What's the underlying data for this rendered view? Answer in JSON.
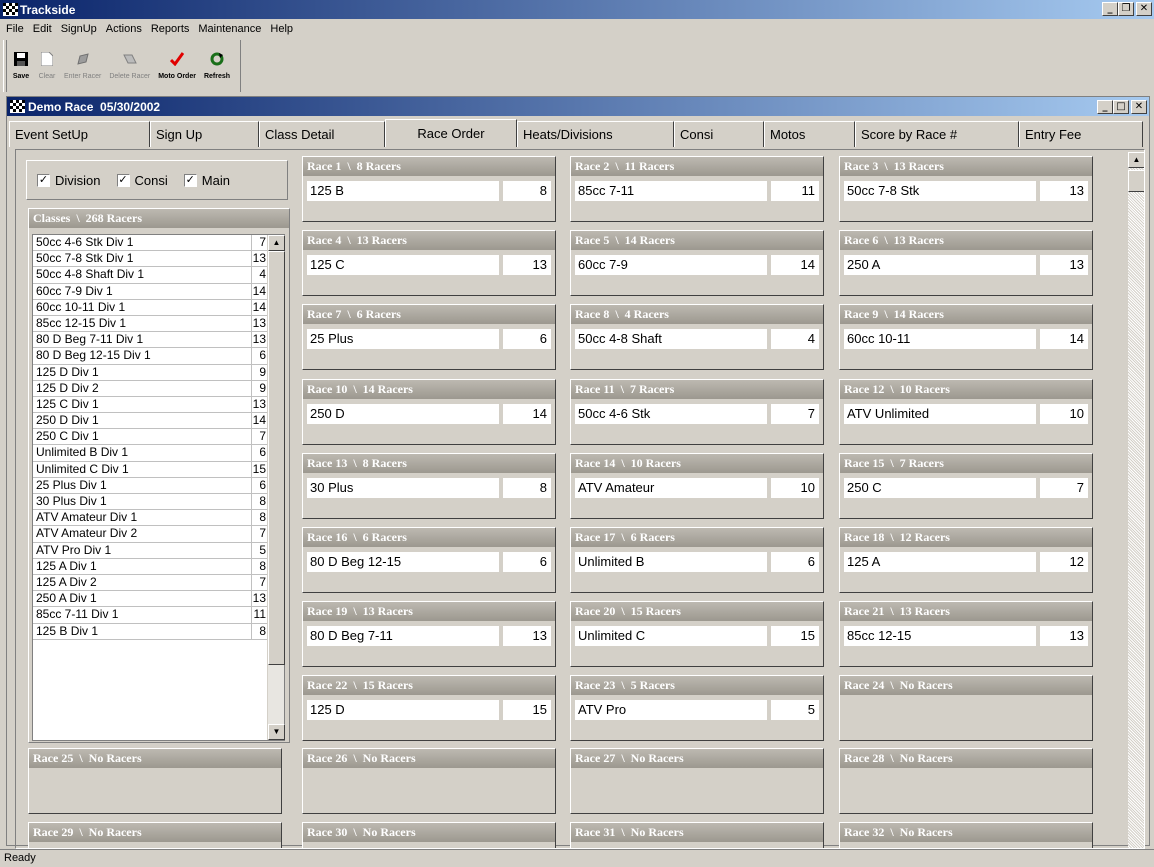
{
  "app": {
    "title": "Trackside"
  },
  "menu": [
    "File",
    "Edit",
    "SignUp",
    "Actions",
    "Reports",
    "Maintenance",
    "Help"
  ],
  "toolbar": {
    "save": "Save",
    "clear": "Clear",
    "enter_racer": "Enter Racer",
    "delete_racer": "Delete Racer",
    "moto_order": "Moto Order",
    "refresh": "Refresh"
  },
  "child": {
    "title": "Demo Race  05/30/2002"
  },
  "tabs": [
    "Event SetUp",
    "Sign Up",
    "Class Detail",
    "Race Order",
    "Heats/Divisions",
    "Consi",
    "Motos",
    "Score by Race #",
    "Entry Fee"
  ],
  "filters": {
    "division": "Division",
    "consi": "Consi",
    "main": "Main"
  },
  "classes": {
    "header": "Classes  \\  268 Racers",
    "rows": [
      {
        "name": "50cc 4-6 Stk Div 1",
        "count": "7"
      },
      {
        "name": "50cc 7-8 Stk Div 1",
        "count": "13"
      },
      {
        "name": "50cc 4-8 Shaft Div 1",
        "count": "4"
      },
      {
        "name": "60cc 7-9 Div 1",
        "count": "14"
      },
      {
        "name": "60cc 10-11 Div 1",
        "count": "14"
      },
      {
        "name": "85cc 12-15 Div 1",
        "count": "13"
      },
      {
        "name": "80 D Beg 7-11 Div 1",
        "count": "13"
      },
      {
        "name": "80 D Beg 12-15 Div 1",
        "count": "6"
      },
      {
        "name": "125 D Div 1",
        "count": "9"
      },
      {
        "name": "125 D Div 2",
        "count": "9"
      },
      {
        "name": "125 C Div 1",
        "count": "13"
      },
      {
        "name": "250 D Div 1",
        "count": "14"
      },
      {
        "name": "250 C Div 1",
        "count": "7"
      },
      {
        "name": "Unlimited B Div 1",
        "count": "6"
      },
      {
        "name": "Unlimited C Div 1",
        "count": "15"
      },
      {
        "name": "25 Plus Div 1",
        "count": "6"
      },
      {
        "name": "30 Plus Div 1",
        "count": "8"
      },
      {
        "name": "ATV Amateur Div 1",
        "count": "8"
      },
      {
        "name": "ATV Amateur Div 2",
        "count": "7"
      },
      {
        "name": "ATV Pro Div 1",
        "count": "5"
      },
      {
        "name": "125 A Div 1",
        "count": "8"
      },
      {
        "name": "125 A Div 2",
        "count": "7"
      },
      {
        "name": "250 A Div 1",
        "count": "13"
      },
      {
        "name": "85cc 7-11 Div 1",
        "count": "11"
      },
      {
        "name": "125 B Div 1",
        "count": "8"
      }
    ]
  },
  "races": [
    {
      "header": "Race 1  \\  8 Racers",
      "name": "125 B",
      "count": "8"
    },
    {
      "header": "Race 2  \\  11 Racers",
      "name": "85cc 7-11",
      "count": "11"
    },
    {
      "header": "Race 3  \\  13 Racers",
      "name": "50cc 7-8 Stk",
      "count": "13"
    },
    {
      "header": "Race 4  \\  13 Racers",
      "name": "125 C",
      "count": "13"
    },
    {
      "header": "Race 5  \\  14 Racers",
      "name": "60cc 7-9",
      "count": "14"
    },
    {
      "header": "Race 6  \\  13 Racers",
      "name": "250 A",
      "count": "13"
    },
    {
      "header": "Race 7  \\  6 Racers",
      "name": "25 Plus",
      "count": "6"
    },
    {
      "header": "Race 8  \\  4 Racers",
      "name": "50cc 4-8 Shaft",
      "count": "4"
    },
    {
      "header": "Race 9  \\  14 Racers",
      "name": "60cc 10-11",
      "count": "14"
    },
    {
      "header": "Race 10  \\  14 Racers",
      "name": "250 D",
      "count": "14"
    },
    {
      "header": "Race 11  \\  7 Racers",
      "name": "50cc 4-6 Stk",
      "count": "7"
    },
    {
      "header": "Race 12  \\  10 Racers",
      "name": "ATV Unlimited",
      "count": "10"
    },
    {
      "header": "Race 13  \\  8 Racers",
      "name": "30 Plus",
      "count": "8"
    },
    {
      "header": "Race 14  \\  10 Racers",
      "name": "ATV Amateur",
      "count": "10"
    },
    {
      "header": "Race 15  \\  7 Racers",
      "name": "250 C",
      "count": "7"
    },
    {
      "header": "Race 16  \\  6 Racers",
      "name": "80 D Beg 12-15",
      "count": "6"
    },
    {
      "header": "Race 17  \\  6 Racers",
      "name": "Unlimited B",
      "count": "6"
    },
    {
      "header": "Race 18  \\  12 Racers",
      "name": "125 A",
      "count": "12"
    },
    {
      "header": "Race 19  \\  13 Racers",
      "name": "80 D Beg 7-11",
      "count": "13"
    },
    {
      "header": "Race 20  \\  15 Racers",
      "name": "Unlimited C",
      "count": "15"
    },
    {
      "header": "Race 21  \\  13 Racers",
      "name": "85cc 12-15",
      "count": "13"
    },
    {
      "header": "Race 22  \\  15 Racers",
      "name": "125 D",
      "count": "15"
    },
    {
      "header": "Race 23  \\  5 Racers",
      "name": "ATV Pro",
      "count": "5"
    },
    {
      "header": "Race 24  \\  No Racers",
      "name": "",
      "count": ""
    },
    {
      "header": "Race 25  \\  No Racers",
      "name": "",
      "count": ""
    },
    {
      "header": "Race 26  \\  No Racers",
      "name": "",
      "count": ""
    },
    {
      "header": "Race 27  \\  No Racers",
      "name": "",
      "count": ""
    },
    {
      "header": "Race 28  \\  No Racers",
      "name": "",
      "count": ""
    },
    {
      "header": "Race 29  \\  No Racers",
      "name": "",
      "count": ""
    },
    {
      "header": "Race 30  \\  No Racers",
      "name": "",
      "count": ""
    },
    {
      "header": "Race 31  \\  No Racers",
      "name": "",
      "count": ""
    },
    {
      "header": "Race 32  \\  No Racers",
      "name": "",
      "count": ""
    }
  ],
  "status": "Ready"
}
